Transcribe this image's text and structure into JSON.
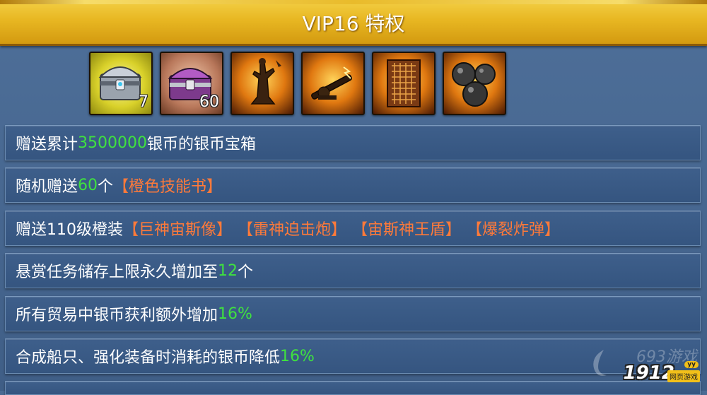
{
  "header": {
    "title": "VIP16 特权"
  },
  "rewards": [
    {
      "icon": "silver-chest-icon",
      "quantity": "7"
    },
    {
      "icon": "purple-chest-icon",
      "quantity": "60"
    },
    {
      "icon": "zeus-statue-icon",
      "quantity": ""
    },
    {
      "icon": "thunder-cannon-icon",
      "quantity": ""
    },
    {
      "icon": "zeus-shield-icon",
      "quantity": ""
    },
    {
      "icon": "explosive-bomb-icon",
      "quantity": ""
    }
  ],
  "privileges": [
    {
      "before": "赠送累计 ",
      "value": "3500000",
      "after": " 银币的银币宝箱"
    },
    {
      "before": "随机赠送 ",
      "value": "60",
      "middle": " 个",
      "item": "【橙色技能书】"
    },
    {
      "before": "赠送110级橙装",
      "items": [
        "【巨神宙斯像】",
        "【雷神迫击炮】",
        "【宙斯神王盾】",
        "【爆裂炸弹】"
      ]
    },
    {
      "before": "悬赏任务储存上限永久增加至 ",
      "value": "12",
      "after": " 个"
    },
    {
      "before": "所有贸易中银币获利额外增加 ",
      "value": "16%"
    },
    {
      "before": "合成船只、强化装备时消耗的银币降低 ",
      "value": "16%"
    }
  ],
  "watermark": {
    "site_text": "693游戏",
    "logo": "1912",
    "logo_badge": "网页游戏",
    "logo_top": "yy"
  },
  "colors": {
    "banner": "#e8b722",
    "highlight_green": "#3fe23f",
    "highlight_orange": "#ff7a3a",
    "row_bg": "#3e5f8b"
  }
}
